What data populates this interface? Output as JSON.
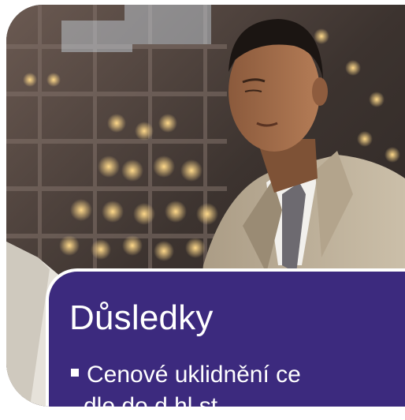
{
  "slide": {
    "title": "Důsledky",
    "bullet_1": "Cenové uklidnění ce",
    "bullet_2": "dle do d hl st"
  },
  "colors": {
    "panel": "#3c2a7e",
    "text": "#ffffff"
  },
  "image": {
    "subject": "man-reading-newspaper-in-suit-in-front-of-office-building"
  }
}
